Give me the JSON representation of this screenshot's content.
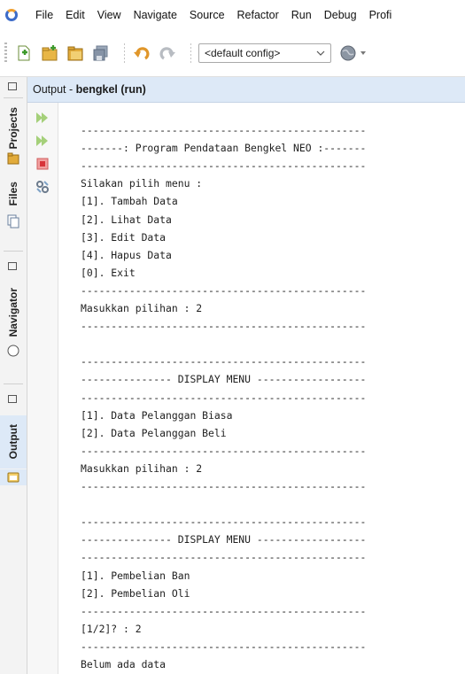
{
  "menubar": {
    "items": [
      "File",
      "Edit",
      "View",
      "Navigate",
      "Source",
      "Refactor",
      "Run",
      "Debug",
      "Profi"
    ]
  },
  "toolbar": {
    "config_value": "<default config>",
    "icons": [
      "new-file-icon",
      "new-project-icon",
      "open-project-icon",
      "save-all-icon",
      "undo-icon",
      "redo-icon",
      "globe-icon"
    ]
  },
  "sidebar": {
    "tabs": [
      "Projects",
      "Files",
      "Navigator",
      "Output"
    ]
  },
  "output_panel": {
    "title_prefix": "Output - ",
    "title_bold": "bengkel (run)"
  },
  "console": {
    "lines": [
      "-----------------------------------------------",
      "-------: Program Pendataan Bengkel NEO :-------",
      "-----------------------------------------------",
      "Silakan pilih menu :",
      "[1]. Tambah Data",
      "[2]. Lihat Data",
      "[3]. Edit Data",
      "[4]. Hapus Data",
      "[0]. Exit",
      "-----------------------------------------------",
      "Masukkan pilihan : 2",
      "-----------------------------------------------",
      "",
      "-----------------------------------------------",
      "--------------- DISPLAY MENU ------------------",
      "-----------------------------------------------",
      "[1]. Data Pelanggan Biasa",
      "[2]. Data Pelanggan Beli",
      "-----------------------------------------------",
      "Masukkan pilihan : 2",
      "-----------------------------------------------",
      "",
      "-----------------------------------------------",
      "--------------- DISPLAY MENU ------------------",
      "-----------------------------------------------",
      "[1]. Pembelian Ban",
      "[2]. Pembelian Oli",
      "-----------------------------------------------",
      "[1/2]? : 2",
      "-----------------------------------------------",
      "Belum ada data"
    ]
  }
}
